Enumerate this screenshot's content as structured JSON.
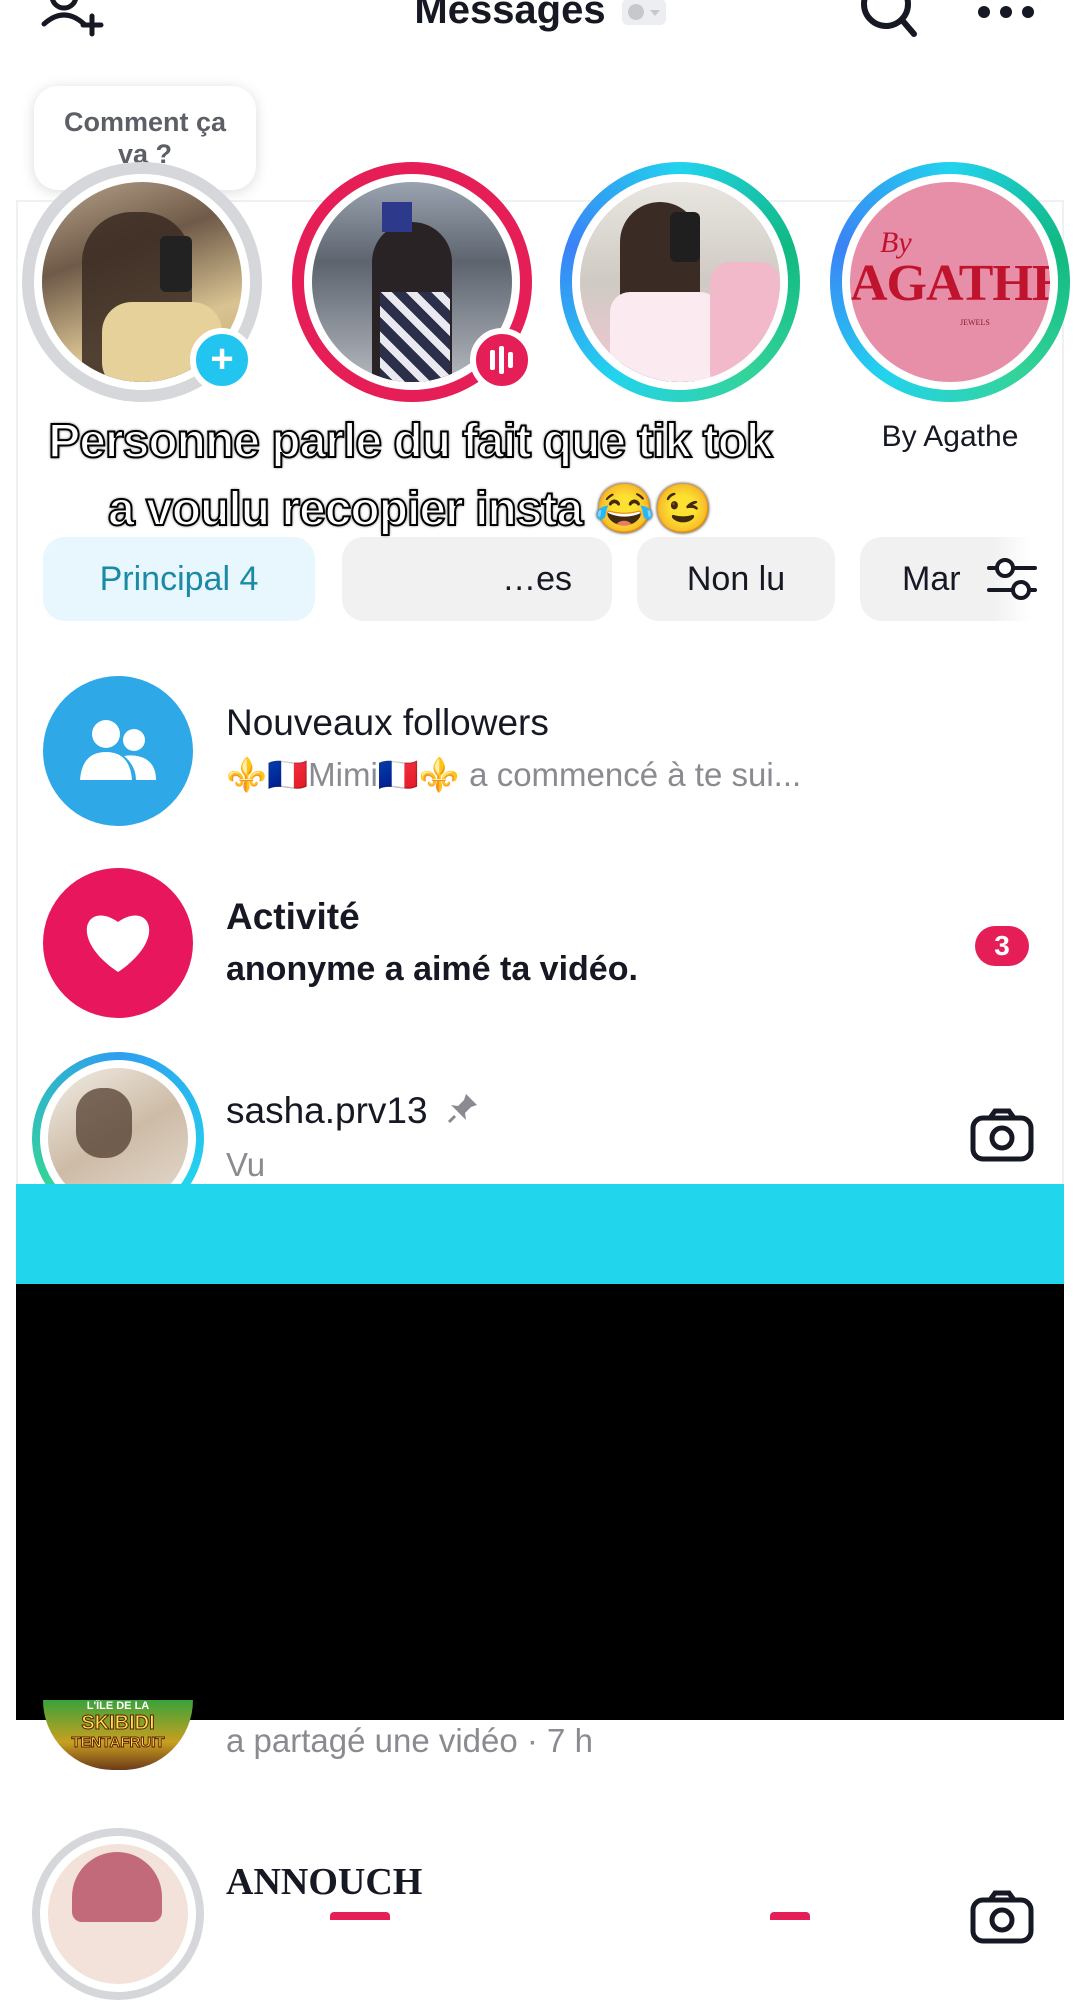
{
  "header": {
    "title": "Messages",
    "icons": [
      "add-friend-icon",
      "search-icon",
      "more-icon"
    ]
  },
  "stories": {
    "bubble_text": "Comment ça\nva ?",
    "items": [
      {
        "name": "",
        "ring": "#d5d7db",
        "badge": "add"
      },
      {
        "name": "",
        "ring": "#e61e58",
        "badge": "live"
      },
      {
        "name": "",
        "ring": "gradient"
      },
      {
        "name": "By Agathe",
        "ring": "gradient",
        "logo_top": "By",
        "logo_main": "AGATHE",
        "logo_sub": "JEWELS"
      }
    ]
  },
  "caption": {
    "text": "Personne parle du fait que tik tok a voulu recopier insta 😂😉"
  },
  "filters": [
    {
      "label": "Principal 4",
      "active": true
    },
    {
      "label": "…es",
      "active": false
    },
    {
      "label": "Non lu",
      "active": false
    },
    {
      "label": "Mar",
      "active": false
    }
  ],
  "list": [
    {
      "title": "Nouveaux followers",
      "subtitle_prefix": "⚜️🇫🇷Mimi🇫🇷⚜️",
      "subtitle": " a commencé à te sui...",
      "icon": "followers-icon",
      "color": "#2ea8e6"
    },
    {
      "title": "Activité",
      "subtitle": "anonyme a aimé ta vidéo.",
      "icon": "heart-icon",
      "color": "#e8175d",
      "count": "3"
    },
    {
      "title": "sasha.prv13",
      "subtitle": "Vu",
      "icon": "camera-icon"
    },
    {
      "title": "",
      "subtitle": "a partagé une vidéo · 7 h",
      "thumb_text_1": "L'ÎLE DE LA",
      "thumb_text_2": "SKIBIDI",
      "thumb_text_3": "TENTAFRUIT"
    },
    {
      "title": "ANNOUCH",
      "subtitle": "",
      "icon": "camera-icon"
    }
  ]
}
